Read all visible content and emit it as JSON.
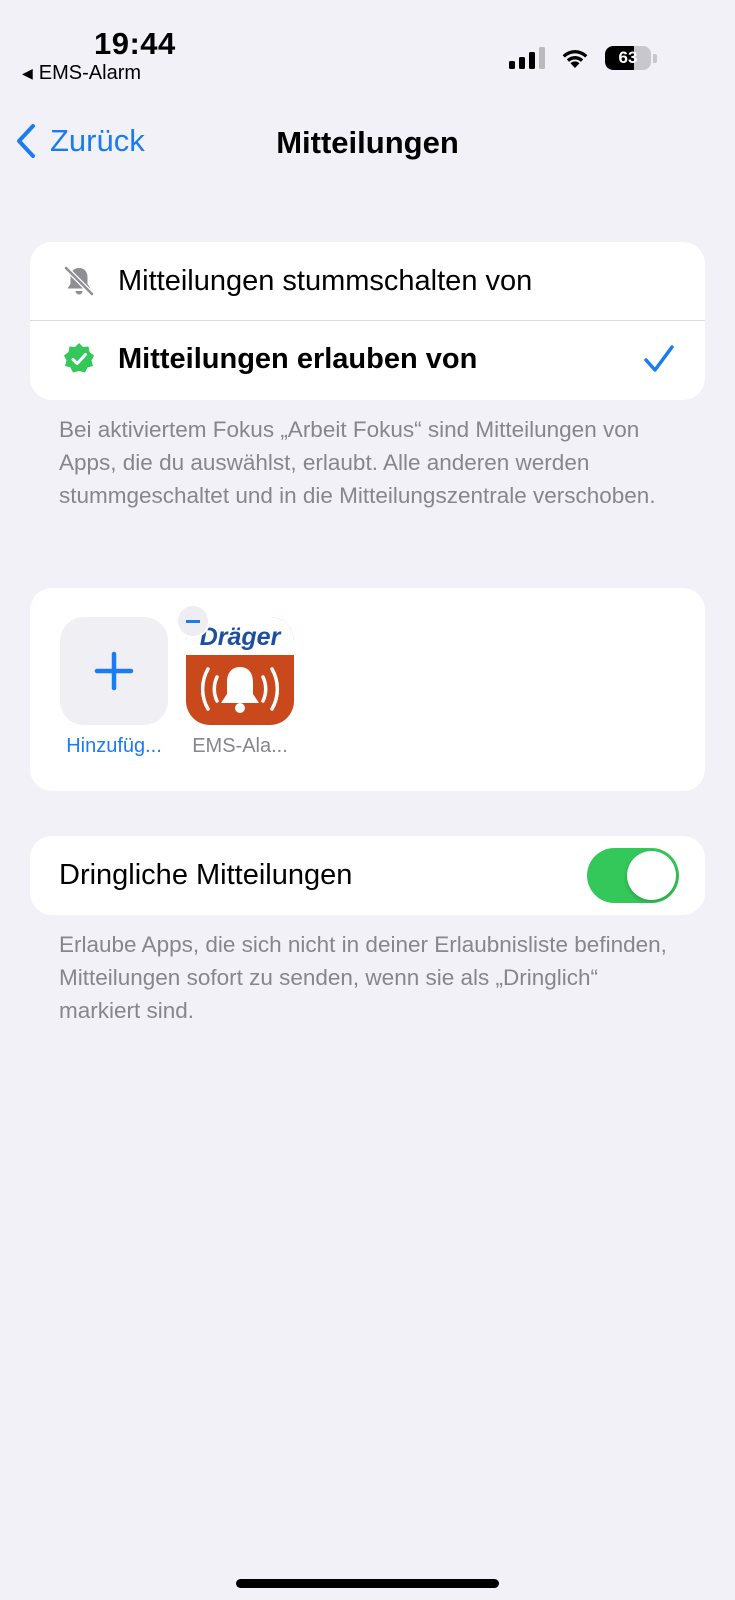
{
  "status_bar": {
    "time": "19:44",
    "back_app": "EMS-Alarm",
    "battery_percent": "63",
    "battery_level": 0.63,
    "signal_bars_active": 3,
    "icons": [
      "signal-icon",
      "wifi-icon",
      "battery-icon"
    ]
  },
  "nav": {
    "back_label": "Zurück",
    "title": "Mitteilungen"
  },
  "mode_options": {
    "silence_label": "Mitteilungen stummschalten von",
    "allow_label": "Mitteilungen erlauben von",
    "selected": "allow"
  },
  "mode_footnote": "Bei aktiviertem Fokus „Arbeit Fokus“ sind Mitteilungen von Apps, die du auswählst, erlaubt. Alle anderen werden stummgeschaltet und in die Mitteilungszentrale verschoben.",
  "apps": {
    "add_label": "Hinzufüg...",
    "items": [
      {
        "name": "EMS-Ala...",
        "brand": "Dräger"
      }
    ]
  },
  "urgent": {
    "label": "Dringliche Mitteilungen",
    "enabled": true,
    "footnote": "Erlaube Apps, die sich nicht in deiner Erlaubnisliste befinden, Mitteilungen sofort zu senden, wenn sie als „Dringlich“ markiert sind."
  },
  "colors": {
    "accent": "#1a7cf4",
    "toggle_on": "#34c759",
    "background": "#f2f1f7",
    "secondary_text": "#86868b",
    "app_icon": "#c9491c"
  }
}
